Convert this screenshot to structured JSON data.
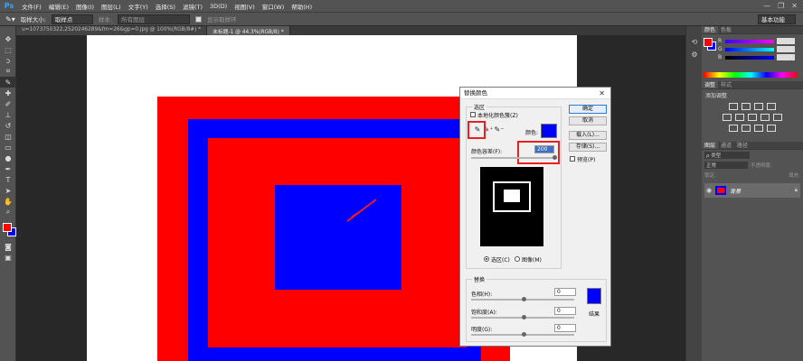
{
  "app": {
    "logo": "Ps",
    "menu": [
      "文件(F)",
      "编辑(E)",
      "图像(I)",
      "图层(L)",
      "文字(Y)",
      "选择(S)",
      "滤镜(T)",
      "3D(D)",
      "视图(V)",
      "窗口(W)",
      "帮助(H)"
    ],
    "window_buttons": [
      "—",
      "❐",
      "✕"
    ]
  },
  "options": {
    "tool_icon": "eyedropper-icon",
    "sample_size_label": "取样大小:",
    "sample_size_value": "取样点",
    "sample_label": "样本:",
    "sample_value": "所有图层",
    "show_ring_label": "显示取样环",
    "workspace": "基本功能"
  },
  "tabs": [
    {
      "label": "u=1073750322,2520246289&fm=26&gp=0.jpg @ 100%(RGB/8#) *",
      "active": false
    },
    {
      "label": "未标题-1 @ 44.3%(RGB/8) *",
      "active": true
    }
  ],
  "tools": [
    "move-icon",
    "marquee-icon",
    "lasso-icon",
    "crop-icon",
    "eyedropper-icon",
    "heal-icon",
    "brush-icon",
    "stamp-icon",
    "history-brush-icon",
    "eraser-icon",
    "gradient-icon",
    "blur-icon",
    "dodge-icon",
    "pen-icon",
    "type-icon",
    "path-select-icon",
    "shape-icon",
    "hand-icon",
    "zoom-icon"
  ],
  "colors": {
    "foreground": "#ff0000",
    "background": "#0000ff",
    "canvas_red": "#ff0000",
    "canvas_blue": "#0000ff",
    "arrow": "#e8201f",
    "highlight": "#e8201f"
  },
  "right_panel": {
    "color_tabs": [
      "颜色",
      "色板"
    ],
    "color_sliders": [
      "R",
      "G",
      "B"
    ],
    "adjust_tabs": [
      "调整",
      "样式"
    ],
    "adjust_title": "添加调整",
    "layer_tabs": [
      "图层",
      "通道",
      "路径"
    ],
    "kind_label": "ρ 类型",
    "blend_mode": "正常",
    "opacity_label": "不透明度:",
    "lock_label": "锁定:",
    "fill_label": "填充:",
    "layer_name": "背景"
  },
  "dialog": {
    "title": "替换颜色",
    "selection_group": "选区",
    "localized_clusters": "本地化颜色簇(Z)",
    "color_label": "颜色:",
    "fuzziness_label": "颜色容差(F):",
    "fuzziness_value": "200",
    "radio_selection": "选区(C)",
    "radio_image": "图像(M)",
    "replace_group": "替换",
    "hue_label": "色相(H):",
    "hue_value": "0",
    "saturation_label": "饱和度(A):",
    "saturation_value": "0",
    "lightness_label": "明度(G):",
    "lightness_value": "0",
    "result_label": "结果",
    "ok": "确定",
    "cancel": "取消",
    "load": "载入(L)...",
    "save": "存储(S)...",
    "preview": "预览(P)",
    "swatch_color": "#0000ff",
    "result_color": "#0000ff"
  }
}
